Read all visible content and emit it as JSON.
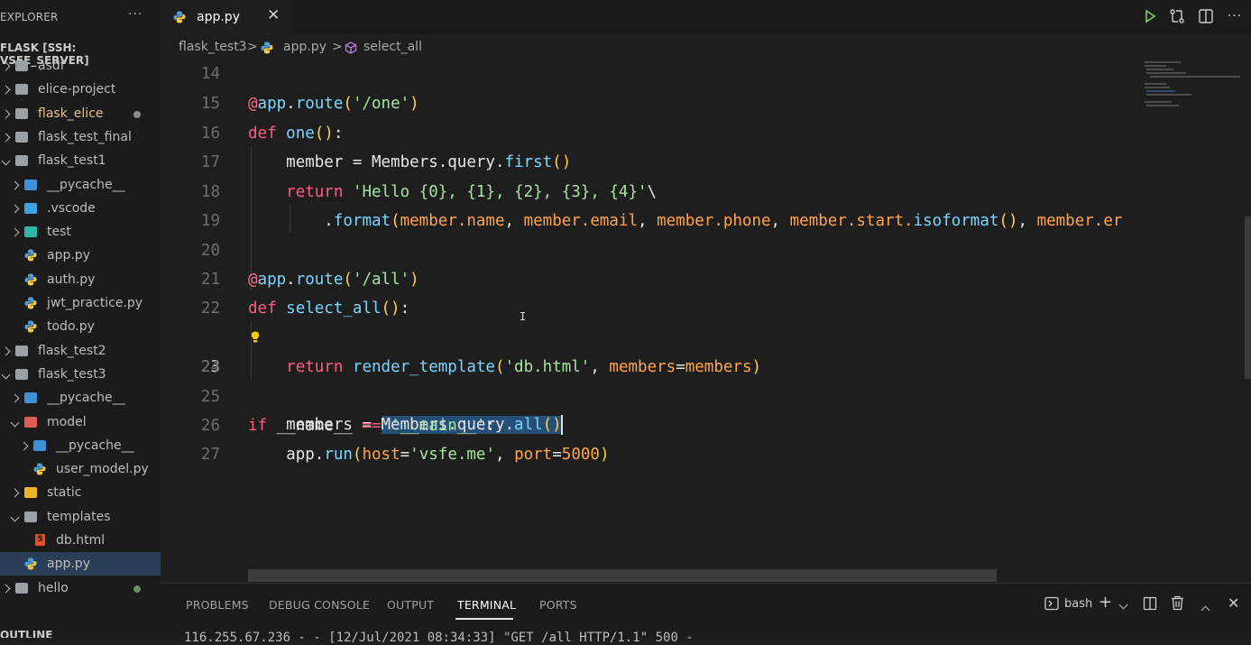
{
  "sidebar": {
    "header": "EXPLORER",
    "more": "···",
    "root": "FLASK [SSH: VSFE_SERVER]",
    "outline": "OUTLINE",
    "items": [
      {
        "label": "asdf",
        "depth": 0,
        "kind": "folder",
        "expanded": false
      },
      {
        "label": "elice-project",
        "depth": 0,
        "kind": "folder",
        "expanded": false
      },
      {
        "label": "flask_elice",
        "depth": 0,
        "kind": "folder",
        "expanded": false,
        "modified": true
      },
      {
        "label": "flask_test_final",
        "depth": 0,
        "kind": "folder",
        "expanded": false
      },
      {
        "label": "flask_test1",
        "depth": 0,
        "kind": "folder",
        "expanded": true
      },
      {
        "label": "__pycache__",
        "depth": 1,
        "kind": "folder-py",
        "expanded": false
      },
      {
        "label": ".vscode",
        "depth": 1,
        "kind": "folder-vscode",
        "expanded": false
      },
      {
        "label": "test",
        "depth": 1,
        "kind": "folder-test",
        "expanded": false
      },
      {
        "label": "app.py",
        "depth": 1,
        "kind": "py"
      },
      {
        "label": "auth.py",
        "depth": 1,
        "kind": "py"
      },
      {
        "label": "jwt_practice.py",
        "depth": 1,
        "kind": "py"
      },
      {
        "label": "todo.py",
        "depth": 1,
        "kind": "py"
      },
      {
        "label": "flask_test2",
        "depth": 0,
        "kind": "folder",
        "expanded": false
      },
      {
        "label": "flask_test3",
        "depth": 0,
        "kind": "folder",
        "expanded": true
      },
      {
        "label": "__pycache__",
        "depth": 1,
        "kind": "folder-py",
        "expanded": false
      },
      {
        "label": "model",
        "depth": 1,
        "kind": "folder-model",
        "expanded": true
      },
      {
        "label": "__pycache__",
        "depth": 2,
        "kind": "folder-py",
        "expanded": false
      },
      {
        "label": "user_model.py",
        "depth": 2,
        "kind": "py"
      },
      {
        "label": "static",
        "depth": 1,
        "kind": "folder-static",
        "expanded": false
      },
      {
        "label": "templates",
        "depth": 1,
        "kind": "folder",
        "expanded": true
      },
      {
        "label": "db.html",
        "depth": 2,
        "kind": "html"
      },
      {
        "label": "app.py",
        "depth": 1,
        "kind": "py",
        "selected": true
      },
      {
        "label": "hello",
        "depth": 0,
        "kind": "folder",
        "expanded": false,
        "dot": true
      }
    ]
  },
  "tab": {
    "label": "app.py",
    "close": "✕"
  },
  "breadcrumb": {
    "folder": "flask_test3",
    "file": "app.py",
    "symbol": "select_all",
    "sep": ">"
  },
  "editor": {
    "active_line": 23,
    "line_numbers": [
      "14",
      "15",
      "16",
      "17",
      "18",
      "19",
      "20",
      "21",
      "22",
      "23",
      "24",
      "25",
      "26",
      "27"
    ]
  },
  "panel": {
    "tabs": [
      "PROBLEMS",
      "DEBUG CONSOLE",
      "OUTPUT",
      "TERMINAL",
      "PORTS"
    ],
    "active_tab": "TERMINAL",
    "shell": "bash",
    "terminal_line": "116.255.67.236 - - [12/Jul/2021 08:34:33] \"GET /all HTTP/1.1\" 500 -"
  },
  "colors": {
    "accent": "#264f78",
    "selected_row": "#2a3f57",
    "modified": "#e2c08d"
  }
}
